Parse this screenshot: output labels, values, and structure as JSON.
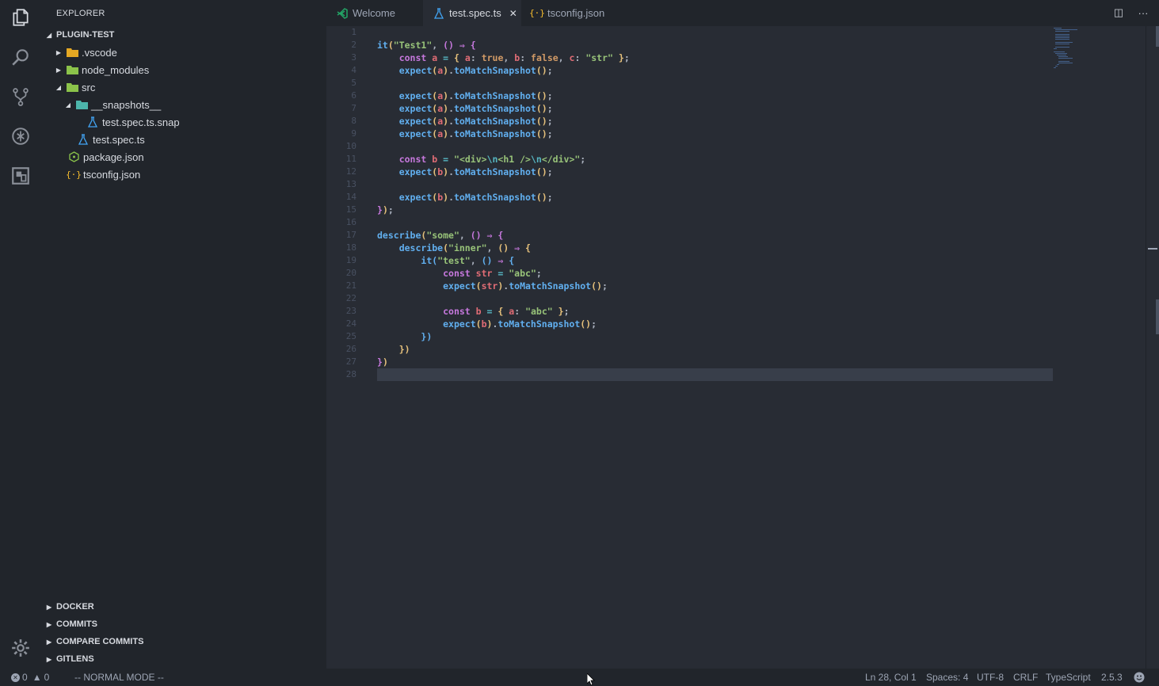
{
  "sidebar": {
    "title": "EXPLORER",
    "project": "PLUGIN-TEST",
    "tree": [
      {
        "label": ".vscode",
        "type": "folder",
        "color": "#e5a823"
      },
      {
        "label": "node_modules",
        "type": "folder",
        "color": "#8bc34a"
      },
      {
        "label": "src",
        "type": "folder",
        "color": "#8bc34a"
      },
      {
        "label": "__snapshots__",
        "type": "folder",
        "color": "#4db6ac"
      },
      {
        "label": "test.spec.ts.snap",
        "type": "file",
        "icon": "flask-icon"
      },
      {
        "label": "test.spec.ts",
        "type": "file",
        "icon": "flask-icon"
      },
      {
        "label": "package.json",
        "type": "file",
        "icon": "nodejs-icon"
      },
      {
        "label": "tsconfig.json",
        "type": "file",
        "icon": "json-icon"
      }
    ],
    "sections": [
      "DOCKER",
      "COMMITS",
      "COMPARE COMMITS",
      "GITLENS"
    ]
  },
  "tabs": [
    {
      "label": "Welcome",
      "icon": "vscode-icon"
    },
    {
      "label": "test.spec.ts",
      "icon": "flask-icon",
      "active": true
    },
    {
      "label": "tsconfig.json",
      "icon": "json-icon"
    }
  ],
  "tab_close_glyph": "✕",
  "tab_actions": [
    {
      "name": "split-editor-icon",
      "glyph": "◫"
    },
    {
      "name": "more-actions-icon",
      "glyph": "···"
    }
  ],
  "editor": {
    "line_count": 28,
    "lines": [
      "",
      "it(\"Test1\", () => {",
      "    const a = { a: true, b: false, c: \"str\" };",
      "    expect(a).toMatchSnapshot();",
      "",
      "    expect(a).toMatchSnapshot();",
      "    expect(a).toMatchSnapshot();",
      "    expect(a).toMatchSnapshot();",
      "    expect(a).toMatchSnapshot();",
      "",
      "    const b = \"<div>\\n<h1 />\\n</div>\";",
      "    expect(b).toMatchSnapshot();",
      "",
      "    expect(b).toMatchSnapshot();",
      "});",
      "",
      "describe(\"some\", () => {",
      "    describe(\"inner\", () => {",
      "        it(\"test\", () => {",
      "            const str = \"abc\";",
      "            expect(str).toMatchSnapshot();",
      "",
      "            const b = { a: \"abc\" };",
      "            expect(b).toMatchSnapshot();",
      "        })",
      "    })",
      "})",
      ""
    ]
  },
  "status": {
    "errors": "0",
    "warnings": "0",
    "mode": "-- NORMAL MODE --",
    "position": "Ln 28, Col 1",
    "spaces": "Spaces: 4",
    "encoding": "UTF-8",
    "eol": "CRLF",
    "language": "TypeScript",
    "version": "2.5.3"
  }
}
